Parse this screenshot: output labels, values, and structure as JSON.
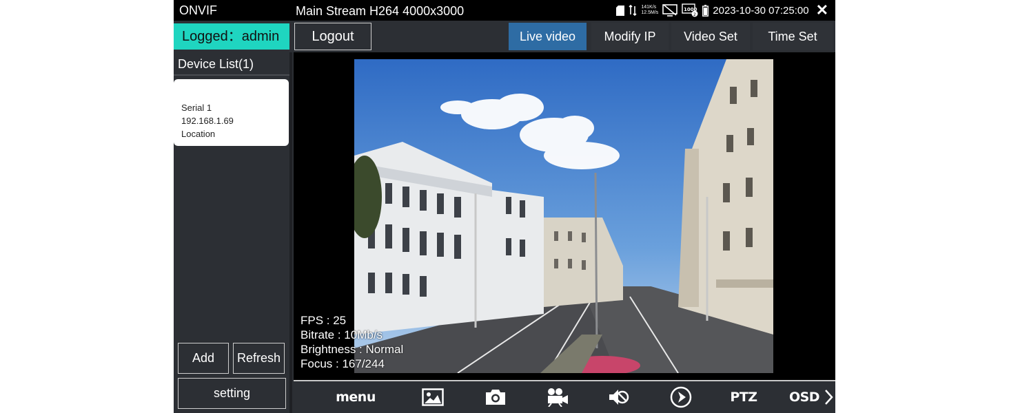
{
  "status_bar": {
    "app_name": "ONVIF",
    "stream_title": "Main Stream H264 4000x3000",
    "net_up": "141K/s",
    "net_down": "12.5M/s",
    "datetime": "2023-10-30 07:25:00",
    "close_symbol": "✕"
  },
  "header": {
    "logged_in": "Logged：admin",
    "logout_label": "Logout",
    "tabs": [
      {
        "label": "Live video",
        "active": true
      },
      {
        "label": "Modify IP",
        "active": false
      },
      {
        "label": "Video Set",
        "active": false
      },
      {
        "label": "Time Set",
        "active": false
      }
    ]
  },
  "sidebar": {
    "device_list_title": "Device List(1)",
    "devices": [
      {
        "name": "Serial 1",
        "ip": "192.168.1.69",
        "location": "Location"
      }
    ],
    "add_label": "Add",
    "refresh_label": "Refresh",
    "setting_label": "setting"
  },
  "video": {
    "fps": "FPS : 25",
    "bitrate": "Bitrate : 10Mb/s",
    "brightness": "Brightness : Normal",
    "focus": "Focus : 167/244"
  },
  "toolbar": {
    "menu_label": "menu",
    "ptz_label": "PTZ",
    "osd_label": "OSD",
    "icons": [
      "image-icon",
      "camera-icon",
      "video-record-icon",
      "mute-icon",
      "play-icon",
      "chevron-right-icon"
    ]
  },
  "colors": {
    "accent_teal": "#1fd5c0",
    "active_tab": "#2e6ca4",
    "panel_bg": "#2c2f34",
    "status_bar_bg": "#000000"
  }
}
